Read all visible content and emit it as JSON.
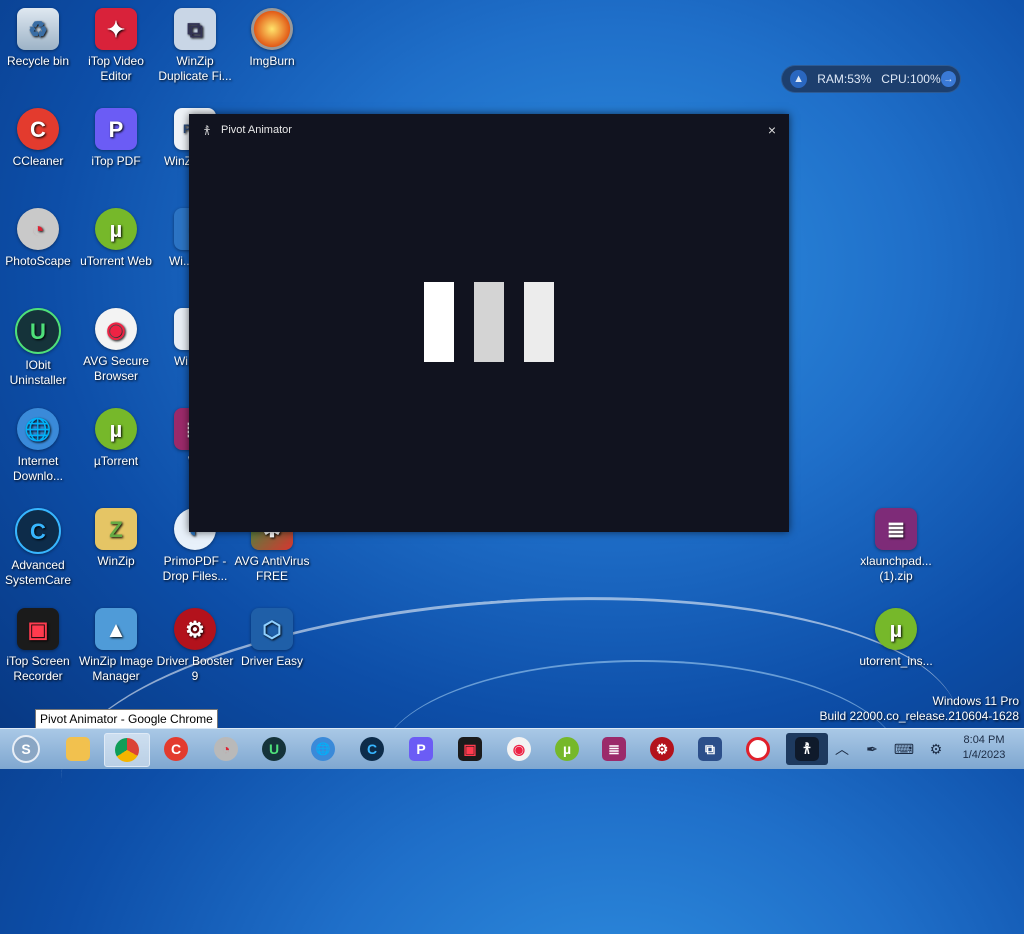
{
  "desktop": {
    "icons": [
      {
        "label": "Recycle bin"
      },
      {
        "label": "iTop Video Editor"
      },
      {
        "label": "WinZip Duplicate Fi..."
      },
      {
        "label": "ImgBurn"
      },
      {
        "label": "CCleaner"
      },
      {
        "label": "iTop PDF"
      },
      {
        "label": "WinZ... Exp"
      },
      {
        "label": "PhotoScape"
      },
      {
        "label": "uTorrent Web"
      },
      {
        "label": "Wi... Safe"
      },
      {
        "label": "IObit Uninstaller"
      },
      {
        "label": "AVG Secure Browser"
      },
      {
        "label": "Wi... Se"
      },
      {
        "label": "Internet Downlo..."
      },
      {
        "label": "µTorrent"
      },
      {
        "label": "Wi"
      },
      {
        "label": "Advanced SystemCare"
      },
      {
        "label": "WinZip"
      },
      {
        "label": "PrimoPDF - Drop Files..."
      },
      {
        "label": "AVG AntiVirus FREE"
      },
      {
        "label": "iTop Screen Recorder"
      },
      {
        "label": "WinZip Image Manager"
      },
      {
        "label": "Driver Booster 9"
      },
      {
        "label": "Driver Easy"
      },
      {
        "label": "xlaunchpad... (1).zip"
      },
      {
        "label": "utorrent_ins..."
      }
    ]
  },
  "monitor": {
    "ram": "RAM:53%",
    "cpu": "CPU:100%"
  },
  "window": {
    "title": "Pivot Animator",
    "close": "×"
  },
  "tooltip": "Pivot Animator - Google Chrome",
  "watermark": {
    "line1": "Windows 11 Pro",
    "line2": "Build 22000.co_release.210604-1628"
  },
  "clock": {
    "time": "8:04 PM",
    "date": "1/4/2023"
  },
  "colors": {
    "window_bg": "#11131f",
    "accent": "#1f6fc9"
  }
}
